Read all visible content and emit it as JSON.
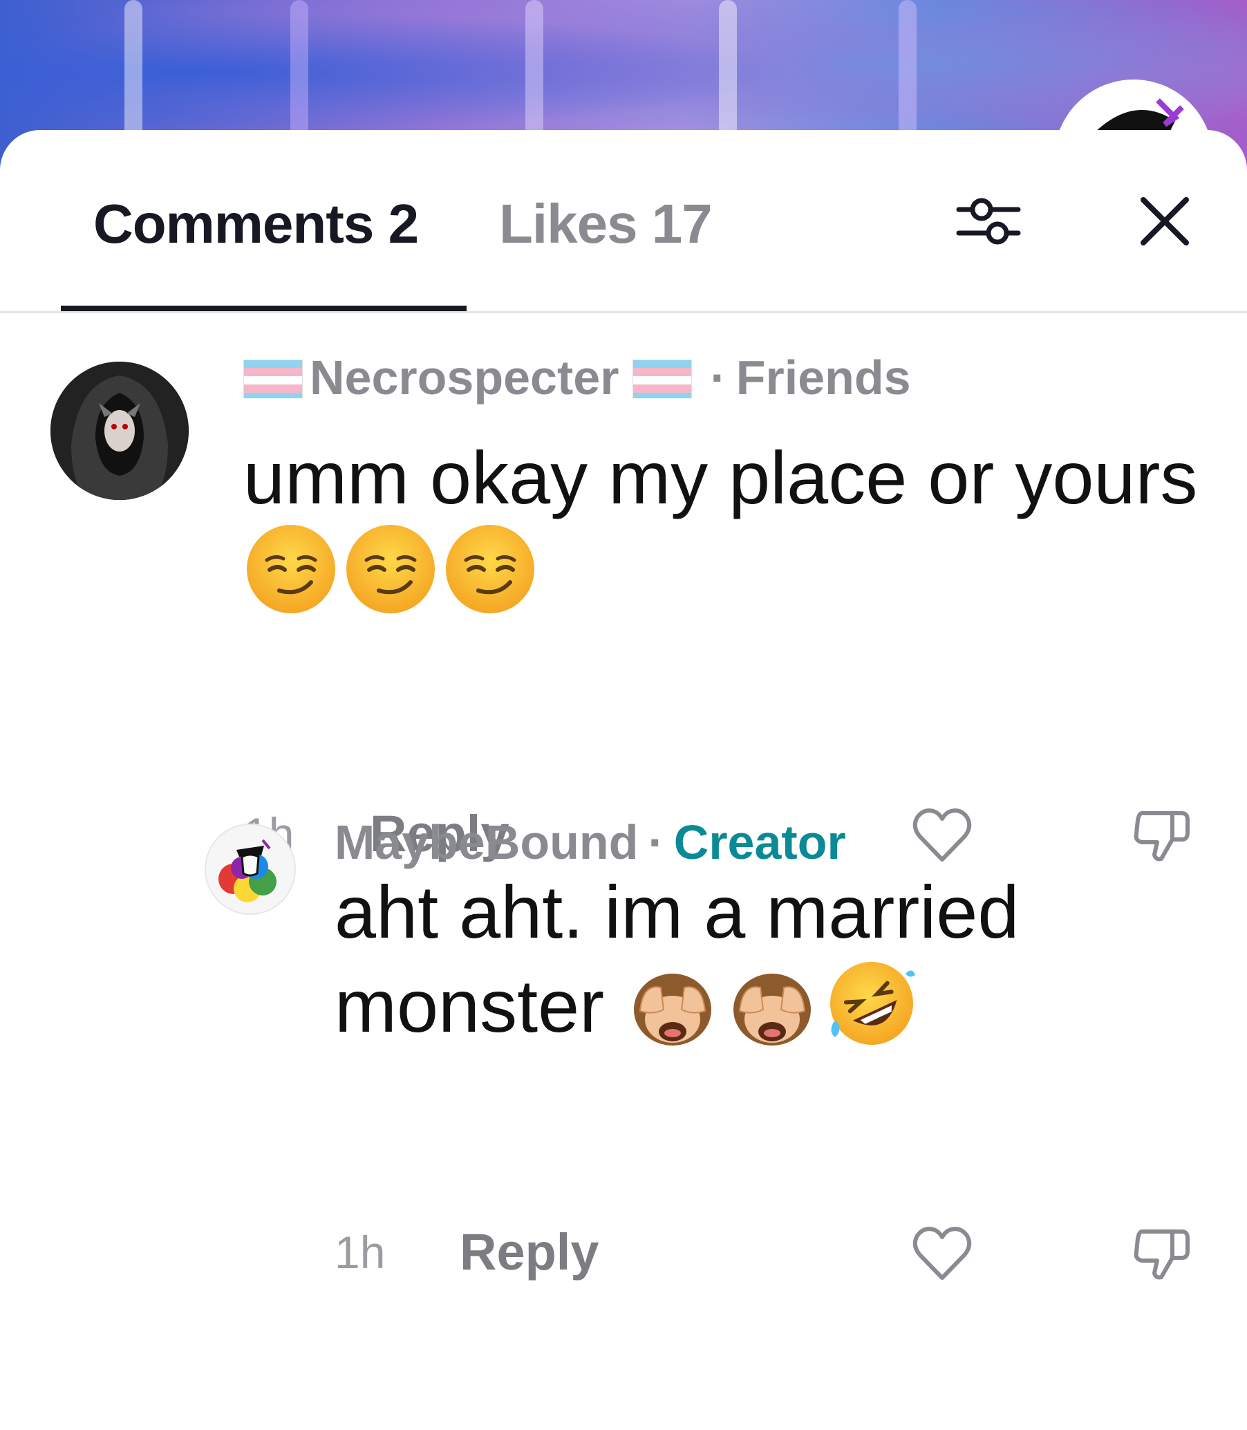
{
  "background": {
    "accent_colors": [
      "#3d5fcf",
      "#8f74d6",
      "#a58fe0",
      "#6b86dc",
      "#a35ec9"
    ]
  },
  "tabs": {
    "comments_label": "Comments 2",
    "likes_label": "Likes 17",
    "active": "comments"
  },
  "toolbar": {
    "filter_icon": "sliders-icon",
    "close_icon": "close-icon"
  },
  "comments": [
    {
      "username": "Necrospecter",
      "flag_icon": "transgender-flag-icon",
      "separator": "·",
      "relation": "Friends",
      "text": "umm okay my place or yours",
      "emojis": [
        "smirking-face-emoji",
        "smirking-face-emoji",
        "smirking-face-emoji"
      ],
      "time": "1h",
      "reply_label": "Reply"
    },
    {
      "username": "MaybeBound",
      "separator": "·",
      "badge": "Creator",
      "badge_color": "#0a8a95",
      "text": "aht aht. im a married monster",
      "emojis": [
        "see-no-evil-monkey-emoji",
        "see-no-evil-monkey-emoji",
        "rolling-on-floor-laughing-emoji"
      ],
      "time": "1h",
      "reply_label": "Reply"
    }
  ]
}
